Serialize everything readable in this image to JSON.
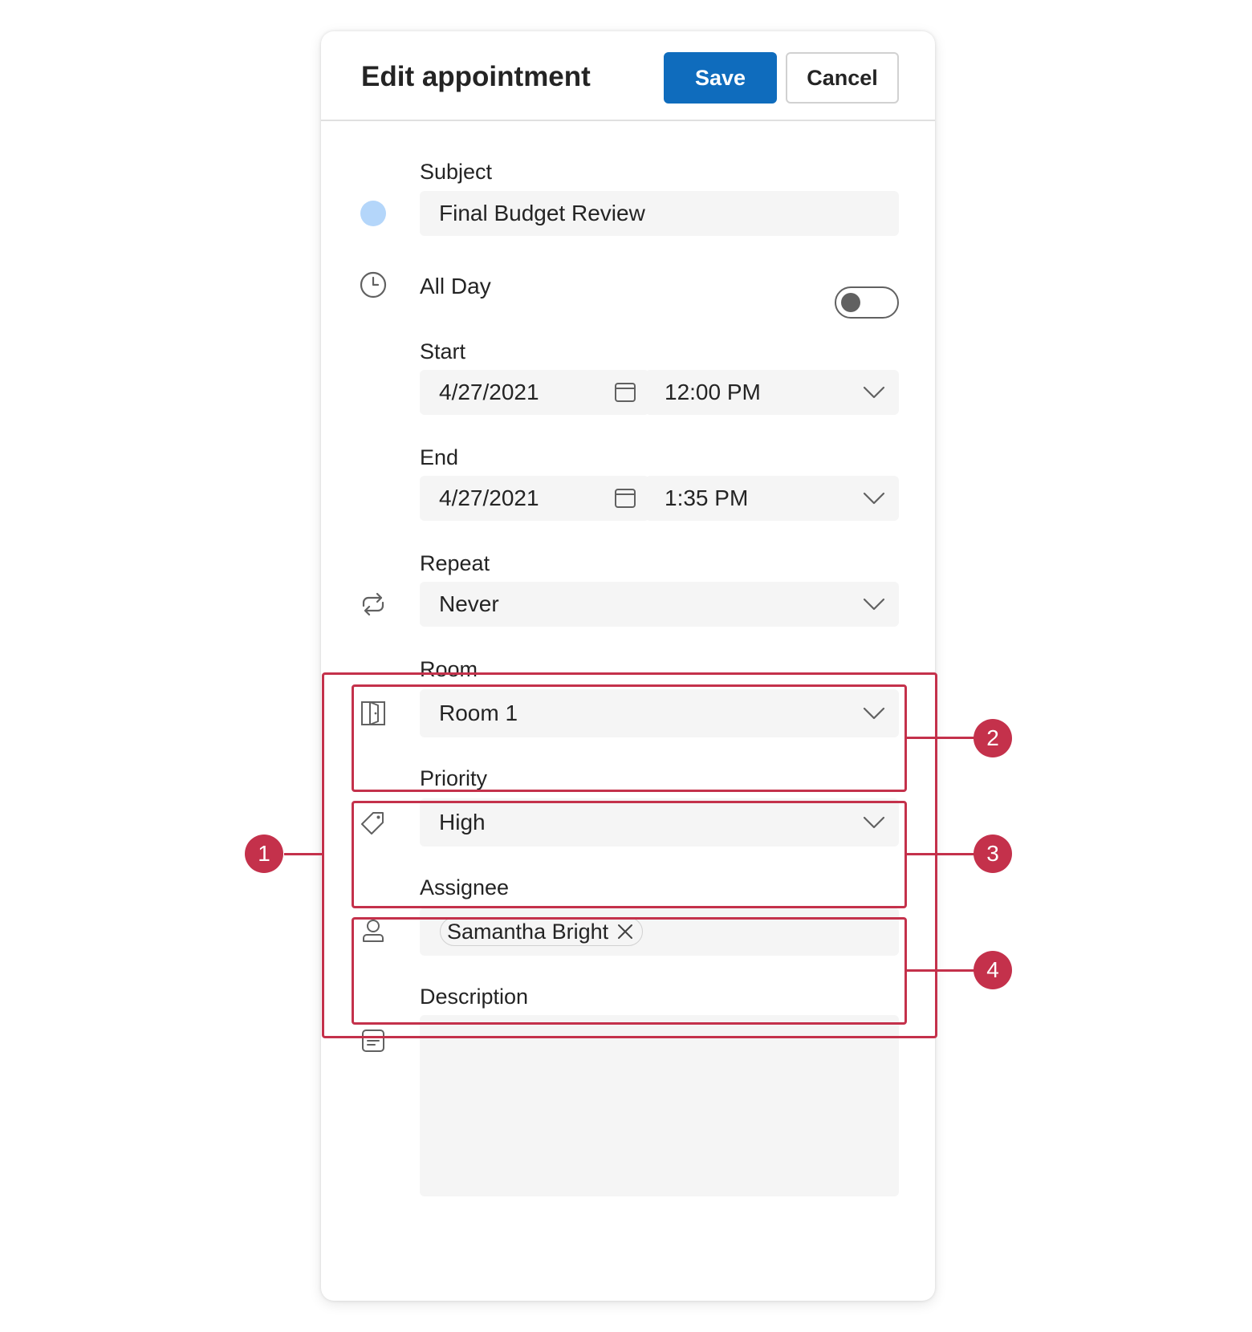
{
  "header": {
    "title": "Edit appointment",
    "save_label": "Save",
    "cancel_label": "Cancel"
  },
  "subject": {
    "label": "Subject",
    "value": "Final Budget Review",
    "color": "#b4d6fa"
  },
  "all_day": {
    "label": "All Day",
    "on": false
  },
  "start": {
    "label": "Start",
    "date": "4/27/2021",
    "time": "12:00 PM"
  },
  "end": {
    "label": "End",
    "date": "4/27/2021",
    "time": "1:35 PM"
  },
  "repeat": {
    "label": "Repeat",
    "value": "Never"
  },
  "room": {
    "label": "Room",
    "value": "Room 1"
  },
  "priority": {
    "label": "Priority",
    "value": "High"
  },
  "assignee": {
    "label": "Assignee",
    "chips": [
      "Samantha Bright"
    ]
  },
  "description": {
    "label": "Description",
    "value": ""
  },
  "callouts": [
    "1",
    "2",
    "3",
    "4"
  ],
  "colors": {
    "accent": "#0f6cbd",
    "callout": "#c4314b",
    "field_bg": "#f5f5f5"
  },
  "icons": [
    "clock-icon",
    "calendar-icon",
    "chevron-down-icon",
    "repeat-icon",
    "door-icon",
    "tag-icon",
    "person-icon",
    "notes-icon",
    "dismiss-icon"
  ]
}
